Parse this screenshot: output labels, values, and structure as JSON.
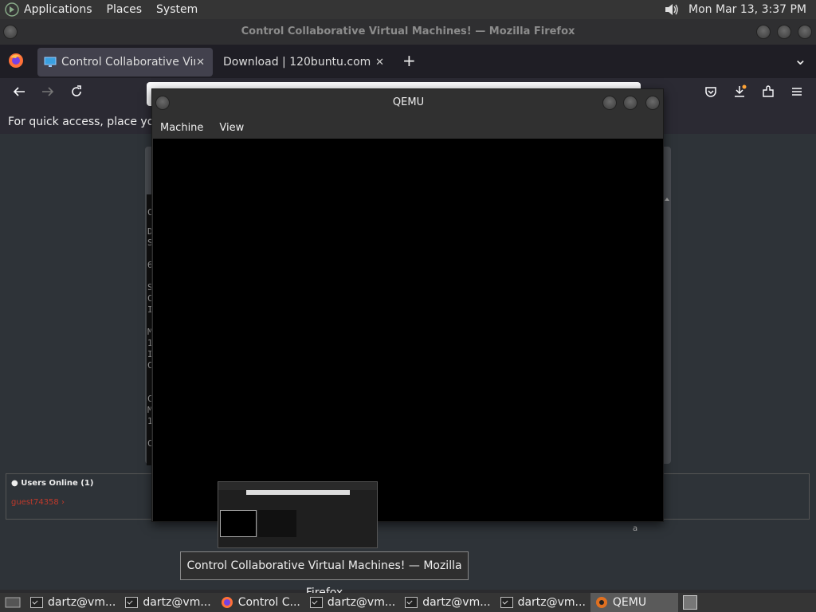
{
  "top_panel": {
    "applications": "Applications",
    "places": "Places",
    "system": "System",
    "clock": "Mon Mar 13,  3:37 PM"
  },
  "firefox": {
    "window_title": "Control Collaborative Virtual Machines! — Mozilla Firefox",
    "tabs": [
      {
        "label": "Control Collaborative Virtua",
        "close": "✕"
      },
      {
        "label": "Download | 120buntu.com",
        "close": "✕"
      }
    ],
    "new_tab": "+",
    "tab_list": "⌄",
    "bookmarks_hint": "For quick access, place your bo"
  },
  "page": {
    "users_online": "Users Online (1)",
    "user": "guest74358",
    "stray_text": "a",
    "console_chars": [
      "C",
      "D",
      "S",
      "6",
      "S",
      "C",
      "I",
      "M",
      "1",
      "I",
      "C",
      "C",
      "M",
      "1",
      "C"
    ]
  },
  "qemu": {
    "title": "QEMU",
    "menu": [
      "Machine",
      "View"
    ]
  },
  "tooltip": "Control Collaborative Virtual Machines! — Mozilla Firefox",
  "taskbar": {
    "items": [
      {
        "label": "dartz@vm..."
      },
      {
        "label": "dartz@vm..."
      },
      {
        "label": "Control C..."
      },
      {
        "label": "dartz@vm..."
      },
      {
        "label": "dartz@vm..."
      },
      {
        "label": "dartz@vm..."
      },
      {
        "label": "QEMU"
      }
    ]
  },
  "colors": {
    "panel": "#353535",
    "tab_bar": "#1f1e25",
    "active_tab": "#42414d",
    "user_red": "#c0392b"
  }
}
